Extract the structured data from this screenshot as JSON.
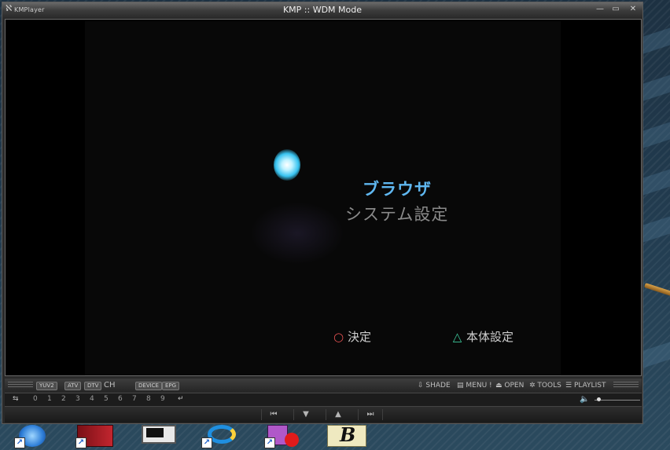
{
  "window": {
    "app_name": "KMPlayer",
    "title": "KMP :: WDM Mode",
    "minimize_glyph": "—",
    "maximize_glyph": "▭",
    "close_glyph": "✕"
  },
  "video": {
    "menu_items": [
      "ブラウザ",
      "システム設定"
    ],
    "hint_confirm": "決定",
    "hint_settings": "本体設定",
    "hint_confirm_glyph": "○",
    "hint_settings_glyph": "△",
    "colors": {
      "selected": "#5fb7f0",
      "unselected": "#8a8a8a",
      "circle": "#e05050",
      "triangle": "#3dc79a"
    }
  },
  "toolbar": {
    "capture_buttons": [
      "YUV2",
      "ATV",
      "DTV"
    ],
    "ch_label": "CH",
    "device_buttons": [
      "DEVICE",
      "EPG"
    ],
    "shade": "SHADE",
    "menu": "MENU",
    "separator": "!",
    "open": "OPEN",
    "tools": "TOOLS",
    "playlist": "PLAYLIST"
  },
  "channel_bar": {
    "numbers": [
      "0",
      "1",
      "2",
      "3",
      "4",
      "5",
      "6",
      "7",
      "8",
      "9"
    ],
    "left_icon": "channel-switch-icon",
    "enter_icon": "enter-icon"
  },
  "transport": {
    "prev_glyph": "⏮",
    "down_glyph": "▼",
    "up_glyph": "▲",
    "next_glyph": "⏭",
    "volume_level": 0.05
  },
  "desktop_icons": [
    "browser-icon",
    "film-icon",
    "tv-icon",
    "refresh-icon",
    "paint-record-icon",
    "b-logo-icon"
  ]
}
